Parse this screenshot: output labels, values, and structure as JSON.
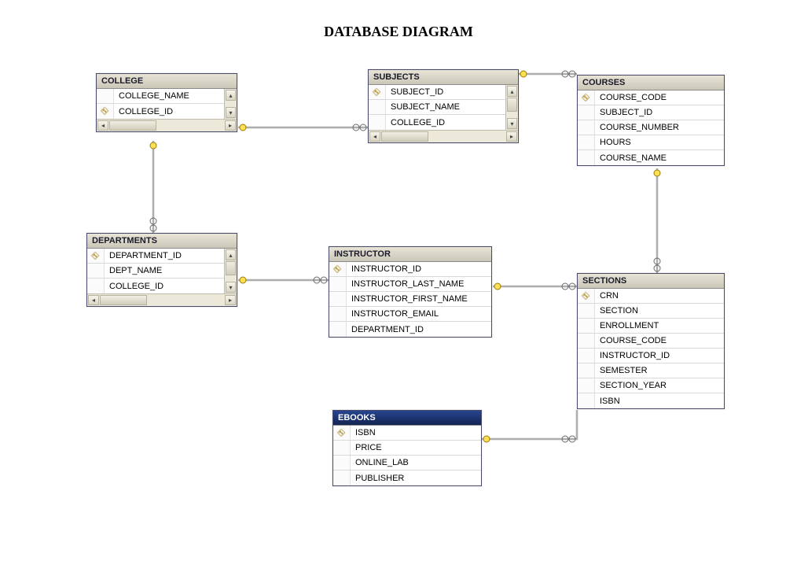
{
  "title": "DATABASE DIAGRAM",
  "tables": {
    "college": {
      "title": "COLLEGE",
      "columns": [
        {
          "name": "COLLEGE_NAME",
          "pk": false
        },
        {
          "name": "COLLEGE_ID",
          "pk": true
        }
      ],
      "hscroll": true,
      "vscroll": true
    },
    "subjects": {
      "title": "SUBJECTS",
      "columns": [
        {
          "name": "SUBJECT_ID",
          "pk": true
        },
        {
          "name": "SUBJECT_NAME",
          "pk": false
        },
        {
          "name": "COLLEGE_ID",
          "pk": false
        }
      ],
      "hscroll": true,
      "vscroll": true
    },
    "courses": {
      "title": "COURSES",
      "columns": [
        {
          "name": "COURSE_CODE",
          "pk": true
        },
        {
          "name": "SUBJECT_ID",
          "pk": false
        },
        {
          "name": "COURSE_NUMBER",
          "pk": false
        },
        {
          "name": "HOURS",
          "pk": false
        },
        {
          "name": "COURSE_NAME",
          "pk": false
        }
      ],
      "hscroll": false,
      "vscroll": false
    },
    "departments": {
      "title": "DEPARTMENTS",
      "columns": [
        {
          "name": "DEPARTMENT_ID",
          "pk": true
        },
        {
          "name": "DEPT_NAME",
          "pk": false
        },
        {
          "name": "COLLEGE_ID",
          "pk": false
        }
      ],
      "hscroll": true,
      "vscroll": true
    },
    "instructor": {
      "title": "INSTRUCTOR",
      "columns": [
        {
          "name": "INSTRUCTOR_ID",
          "pk": true
        },
        {
          "name": "INSTRUCTOR_LAST_NAME",
          "pk": false
        },
        {
          "name": "INSTRUCTOR_FIRST_NAME",
          "pk": false
        },
        {
          "name": "INSTRUCTOR_EMAIL",
          "pk": false
        },
        {
          "name": "DEPARTMENT_ID",
          "pk": false
        }
      ],
      "hscroll": false,
      "vscroll": false
    },
    "sections": {
      "title": "SECTIONS",
      "columns": [
        {
          "name": "CRN",
          "pk": true
        },
        {
          "name": "SECTION",
          "pk": false
        },
        {
          "name": "ENROLLMENT",
          "pk": false
        },
        {
          "name": "COURSE_CODE",
          "pk": false
        },
        {
          "name": "INSTRUCTOR_ID",
          "pk": false
        },
        {
          "name": "SEMESTER",
          "pk": false
        },
        {
          "name": "SECTION_YEAR",
          "pk": false
        },
        {
          "name": "ISBN",
          "pk": false
        }
      ],
      "hscroll": false,
      "vscroll": false
    },
    "ebooks": {
      "title": "EBOOKS",
      "columns": [
        {
          "name": "ISBN",
          "pk": true
        },
        {
          "name": "PRICE",
          "pk": false
        },
        {
          "name": "ONLINE_LAB",
          "pk": false
        },
        {
          "name": "PUBLISHER",
          "pk": false
        }
      ],
      "hscroll": false,
      "vscroll": false
    }
  },
  "relationships": [
    {
      "from": "COLLEGE.COLLEGE_ID",
      "to": "SUBJECTS.COLLEGE_ID"
    },
    {
      "from": "COLLEGE.COLLEGE_ID",
      "to": "DEPARTMENTS.COLLEGE_ID"
    },
    {
      "from": "SUBJECTS.SUBJECT_ID",
      "to": "COURSES.SUBJECT_ID"
    },
    {
      "from": "DEPARTMENTS.DEPARTMENT_ID",
      "to": "INSTRUCTOR.DEPARTMENT_ID"
    },
    {
      "from": "INSTRUCTOR.INSTRUCTOR_ID",
      "to": "SECTIONS.INSTRUCTOR_ID"
    },
    {
      "from": "COURSES.COURSE_CODE",
      "to": "SECTIONS.COURSE_CODE"
    },
    {
      "from": "EBOOKS.ISBN",
      "to": "SECTIONS.ISBN"
    }
  ]
}
